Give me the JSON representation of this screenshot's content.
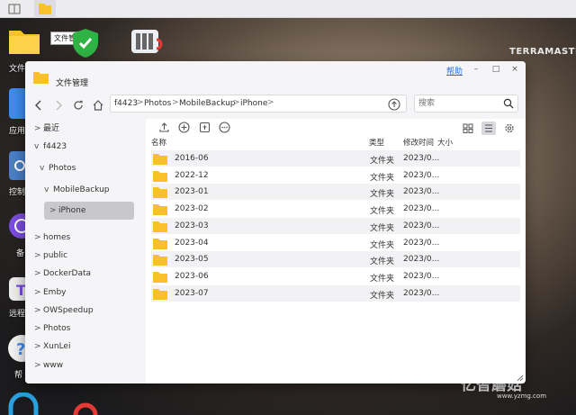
{
  "desktop": {
    "tooltip": "文件管理",
    "brand": "TERRAMASTER",
    "watermark": "亿智蘑菇",
    "watermark_url": "www.yzmg.com",
    "labels": [
      {
        "text": "文件",
        "name": "file-manager"
      },
      {
        "text": "应用",
        "name": "apps"
      },
      {
        "text": "控制",
        "name": "control"
      },
      {
        "text": "备",
        "name": "backup"
      },
      {
        "text": "远程",
        "name": "remote"
      },
      {
        "text": "帮",
        "name": "help"
      }
    ]
  },
  "window": {
    "title": "文件管理",
    "help": "帮助",
    "min": "–",
    "max": "□",
    "close": "×"
  },
  "path": {
    "crumbs": [
      "f4423",
      "Photos",
      "MobileBackup",
      "iPhone"
    ],
    "sep": ">"
  },
  "search": {
    "placeholder": "搜索"
  },
  "sidebar": {
    "items": [
      {
        "label": "最近",
        "chev": ">"
      },
      {
        "label": "f4423",
        "chev": "v"
      },
      {
        "label": "Photos",
        "chev": "v"
      },
      {
        "label": "MobileBackup",
        "chev": "v"
      },
      {
        "label": "iPhone",
        "chev": ">"
      },
      {
        "label": "homes",
        "chev": ">"
      },
      {
        "label": "public",
        "chev": ">"
      },
      {
        "label": "DockerData",
        "chev": ">"
      },
      {
        "label": "Emby",
        "chev": ">"
      },
      {
        "label": "OWSpeedup",
        "chev": ">"
      },
      {
        "label": "Photos",
        "chev": ">"
      },
      {
        "label": "XunLei",
        "chev": ">"
      },
      {
        "label": "www",
        "chev": ">"
      }
    ]
  },
  "table": {
    "headers": {
      "name": "名称",
      "type": "类型",
      "modified": "修改时间",
      "size": "大小"
    },
    "rows": [
      {
        "name": "2016-06",
        "type": "文件夹",
        "modified": "2023/0..."
      },
      {
        "name": "2022-12",
        "type": "文件夹",
        "modified": "2023/0..."
      },
      {
        "name": "2023-01",
        "type": "文件夹",
        "modified": "2023/0..."
      },
      {
        "name": "2023-02",
        "type": "文件夹",
        "modified": "2023/0..."
      },
      {
        "name": "2023-03",
        "type": "文件夹",
        "modified": "2023/0..."
      },
      {
        "name": "2023-04",
        "type": "文件夹",
        "modified": "2023/0..."
      },
      {
        "name": "2023-05",
        "type": "文件夹",
        "modified": "2023/0..."
      },
      {
        "name": "2023-06",
        "type": "文件夹",
        "modified": "2023/0..."
      },
      {
        "name": "2023-07",
        "type": "文件夹",
        "modified": "2023/0..."
      }
    ]
  },
  "colors": {
    "folder": "#f8c12a",
    "accent": "#2a6fd6",
    "sidebar_active": "#c8c8cc"
  }
}
